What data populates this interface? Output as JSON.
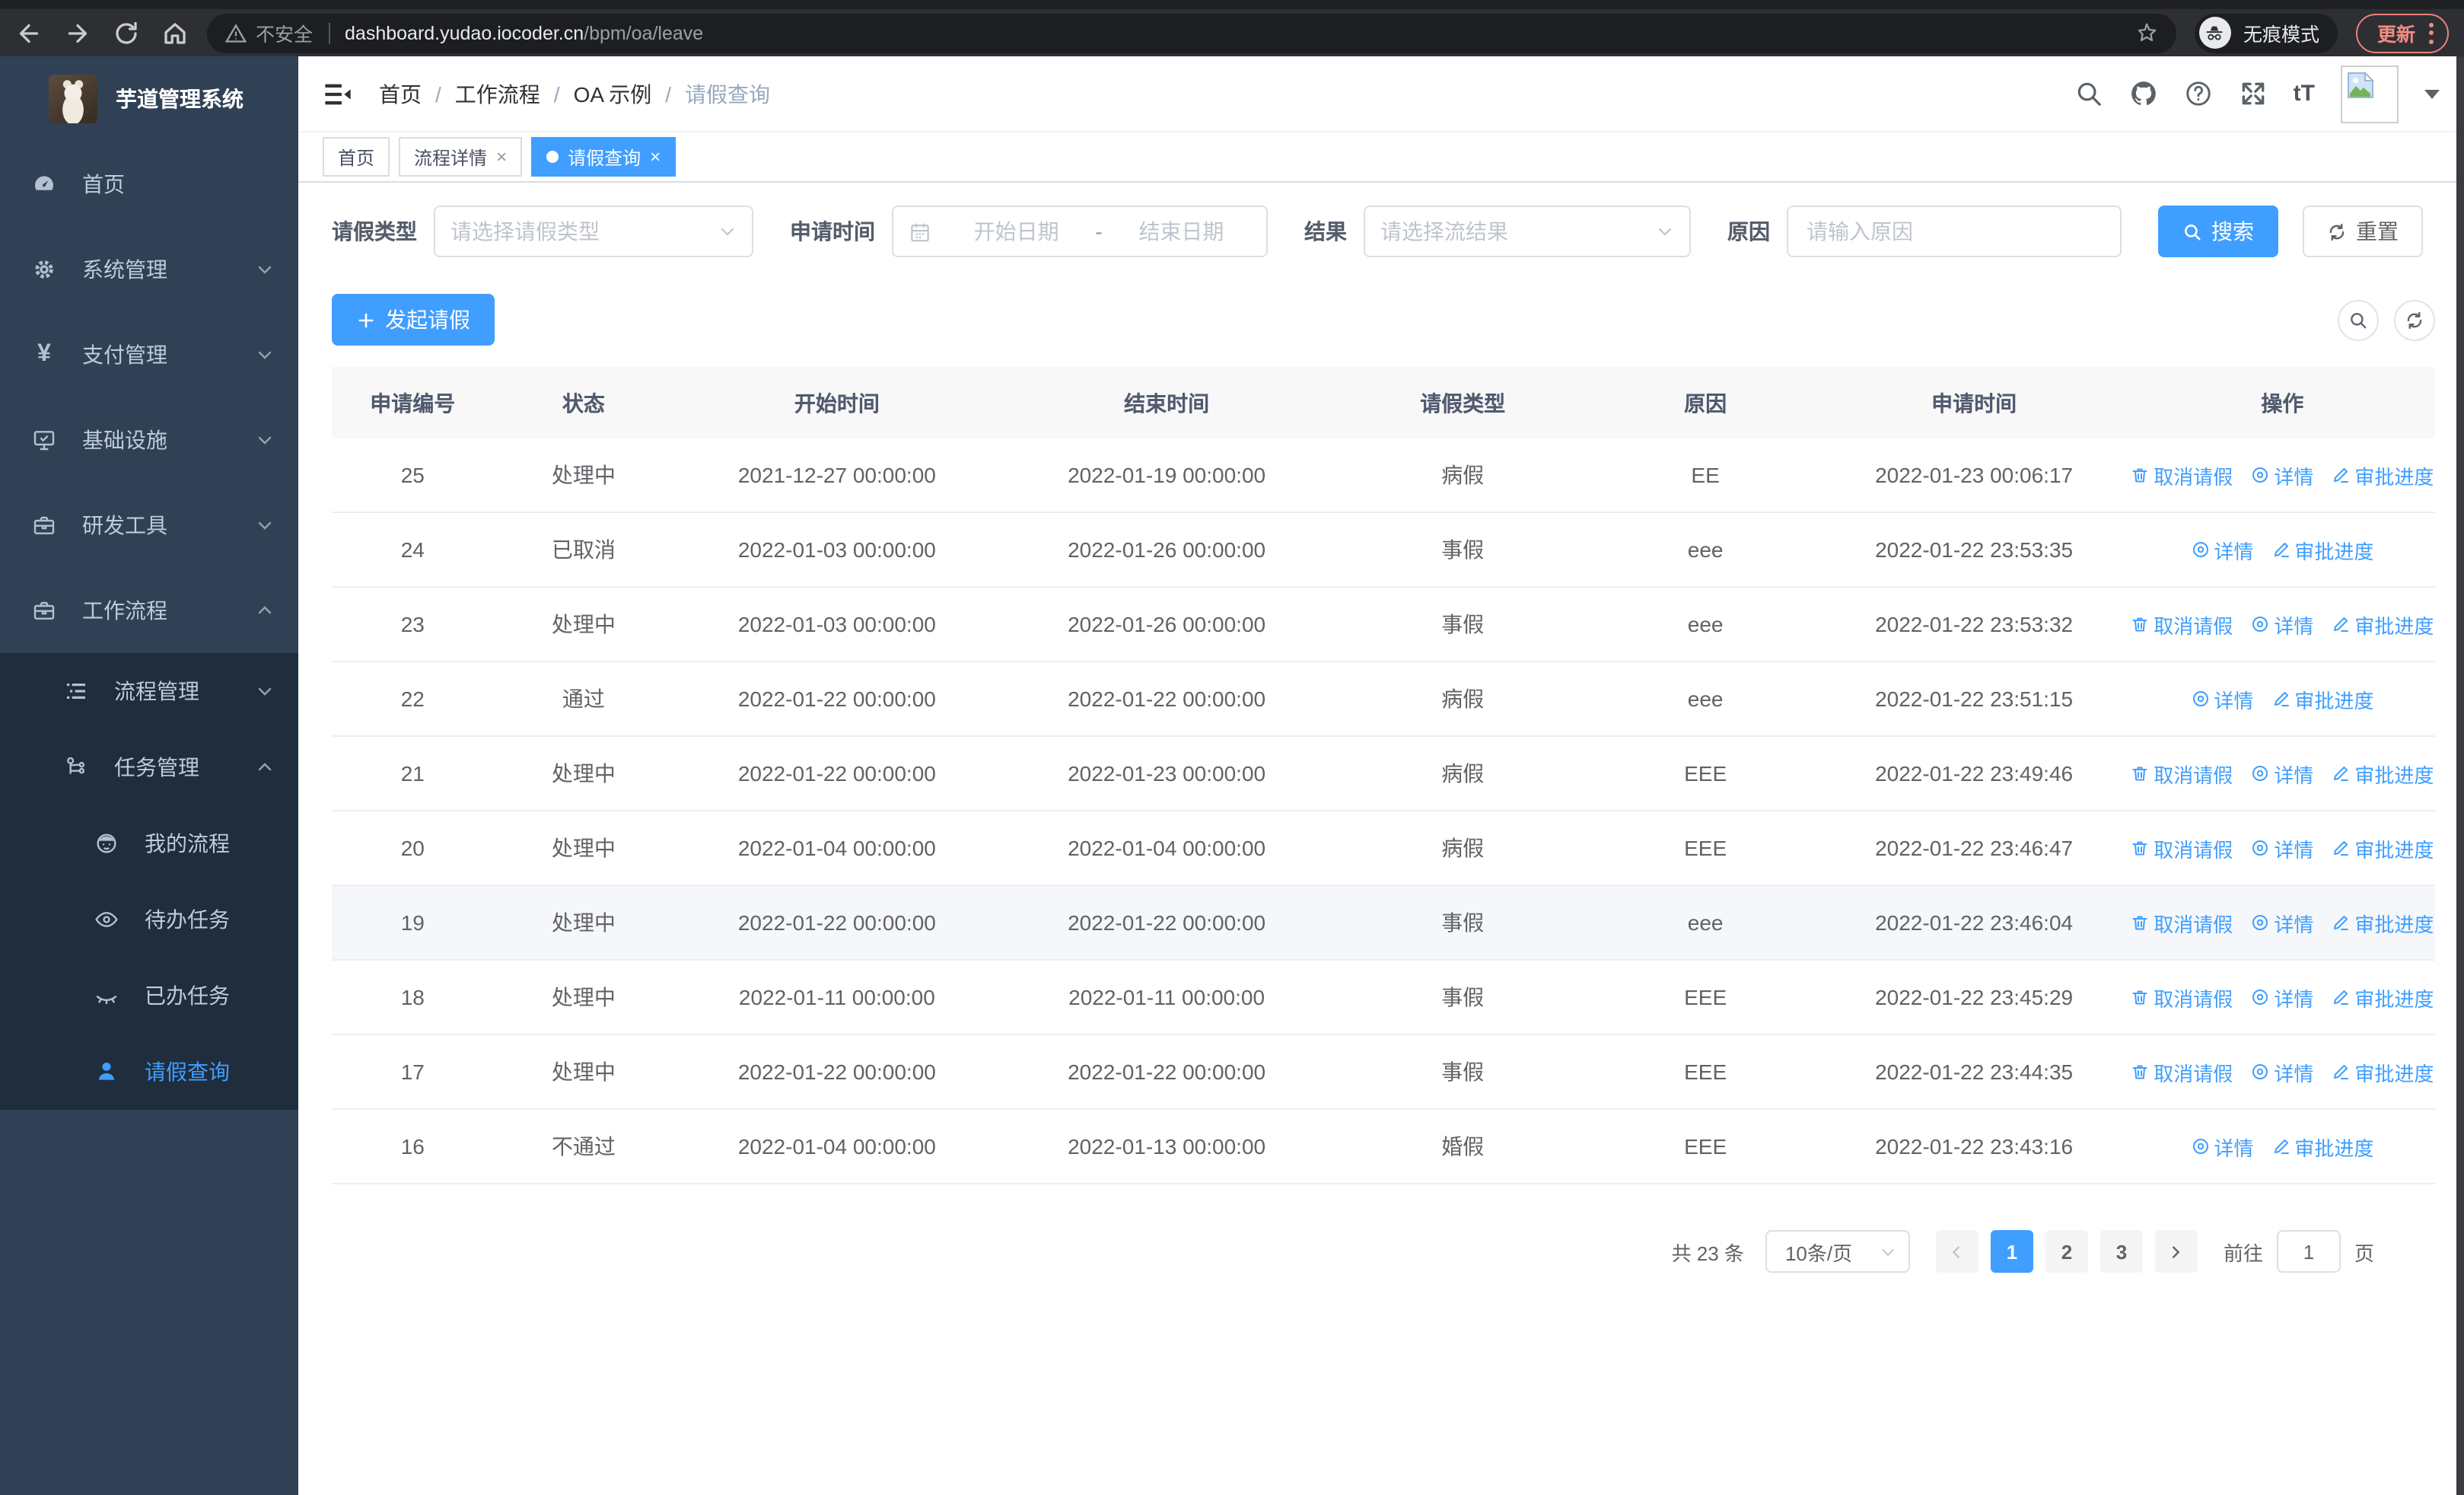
{
  "colors": {
    "accent": "#409eff",
    "sidebar_bg": "#304156",
    "sidebar_submenu_bg": "#1f2d3d",
    "sidebar_text": "#bfcbd9",
    "update_button": "#ef8a80",
    "table_header_bg": "#f8f8f9",
    "hover_row_bg": "#f5f7fa"
  },
  "browser": {
    "security_label": "不安全",
    "url_host": "dashboard.yudao.iocoder.cn",
    "url_path": "/bpm/oa/leave",
    "incognito_label": "无痕模式",
    "update_label": "更新"
  },
  "header": {
    "font_size_glyph": "tT"
  },
  "icons": {
    "yen": "¥",
    "close": "×"
  },
  "sidebar": {
    "title": "芋道管理系统",
    "items": [
      {
        "label": "首页",
        "icon": "dashboard-icon"
      },
      {
        "label": "系统管理",
        "icon": "gear-icon"
      },
      {
        "label": "支付管理",
        "icon": "yen-icon"
      },
      {
        "label": "基础设施",
        "icon": "monitor-icon"
      },
      {
        "label": "研发工具",
        "icon": "toolbox-icon"
      },
      {
        "label": "工作流程",
        "icon": "toolbox-icon"
      }
    ],
    "workflow_children": [
      {
        "label": "流程管理",
        "icon": "tree-list-icon"
      },
      {
        "label": "任务管理",
        "icon": "branch-icon"
      }
    ],
    "task_children": [
      {
        "label": "我的流程",
        "icon": "face-icon"
      },
      {
        "label": "待办任务",
        "icon": "eye-open-icon"
      },
      {
        "label": "已办任务",
        "icon": "eye-closed-icon"
      },
      {
        "label": "请假查询",
        "icon": "user-icon",
        "active": true
      }
    ]
  },
  "breadcrumb": {
    "separator": "/",
    "items": [
      "首页",
      "工作流程",
      "OA 示例",
      "请假查询"
    ]
  },
  "tabs": [
    {
      "label": "首页",
      "closable": false,
      "active": false
    },
    {
      "label": "流程详情",
      "closable": true,
      "active": false
    },
    {
      "label": "请假查询",
      "closable": true,
      "active": true
    }
  ],
  "filters": {
    "leave_type": {
      "label": "请假类型",
      "placeholder": "请选择请假类型"
    },
    "apply_time": {
      "label": "申请时间",
      "start_placeholder": "开始日期",
      "separator": "-",
      "end_placeholder": "结束日期"
    },
    "result": {
      "label": "结果",
      "placeholder": "请选择流结果"
    },
    "reason": {
      "label": "原因",
      "placeholder": "请输入原因"
    },
    "search_label": "搜索",
    "reset_label": "重置"
  },
  "toolbar": {
    "create_label": "发起请假"
  },
  "table": {
    "columns": [
      "申请编号",
      "状态",
      "开始时间",
      "结束时间",
      "请假类型",
      "原因",
      "申请时间",
      "操作"
    ],
    "action_labels": {
      "cancel": "取消请假",
      "detail": "详情",
      "progress": "审批进度"
    },
    "rows": [
      {
        "id": "25",
        "status": "处理中",
        "start": "2021-12-27 00:00:00",
        "end": "2022-01-19 00:00:00",
        "type": "病假",
        "reason": "EE",
        "applied": "2022-01-23 00:06:17",
        "actions": [
          "cancel",
          "detail",
          "progress"
        ],
        "hover": false
      },
      {
        "id": "24",
        "status": "已取消",
        "start": "2022-01-03 00:00:00",
        "end": "2022-01-26 00:00:00",
        "type": "事假",
        "reason": "eee",
        "applied": "2022-01-22 23:53:35",
        "actions": [
          "detail",
          "progress"
        ],
        "hover": false
      },
      {
        "id": "23",
        "status": "处理中",
        "start": "2022-01-03 00:00:00",
        "end": "2022-01-26 00:00:00",
        "type": "事假",
        "reason": "eee",
        "applied": "2022-01-22 23:53:32",
        "actions": [
          "cancel",
          "detail",
          "progress"
        ],
        "hover": false
      },
      {
        "id": "22",
        "status": "通过",
        "start": "2022-01-22 00:00:00",
        "end": "2022-01-22 00:00:00",
        "type": "病假",
        "reason": "eee",
        "applied": "2022-01-22 23:51:15",
        "actions": [
          "detail",
          "progress"
        ],
        "hover": false
      },
      {
        "id": "21",
        "status": "处理中",
        "start": "2022-01-22 00:00:00",
        "end": "2022-01-23 00:00:00",
        "type": "病假",
        "reason": "EEE",
        "applied": "2022-01-22 23:49:46",
        "actions": [
          "cancel",
          "detail",
          "progress"
        ],
        "hover": false
      },
      {
        "id": "20",
        "status": "处理中",
        "start": "2022-01-04 00:00:00",
        "end": "2022-01-04 00:00:00",
        "type": "病假",
        "reason": "EEE",
        "applied": "2022-01-22 23:46:47",
        "actions": [
          "cancel",
          "detail",
          "progress"
        ],
        "hover": false
      },
      {
        "id": "19",
        "status": "处理中",
        "start": "2022-01-22 00:00:00",
        "end": "2022-01-22 00:00:00",
        "type": "事假",
        "reason": "eee",
        "applied": "2022-01-22 23:46:04",
        "actions": [
          "cancel",
          "detail",
          "progress"
        ],
        "hover": true
      },
      {
        "id": "18",
        "status": "处理中",
        "start": "2022-01-11 00:00:00",
        "end": "2022-01-11 00:00:00",
        "type": "事假",
        "reason": "EEE",
        "applied": "2022-01-22 23:45:29",
        "actions": [
          "cancel",
          "detail",
          "progress"
        ],
        "hover": false
      },
      {
        "id": "17",
        "status": "处理中",
        "start": "2022-01-22 00:00:00",
        "end": "2022-01-22 00:00:00",
        "type": "事假",
        "reason": "EEE",
        "applied": "2022-01-22 23:44:35",
        "actions": [
          "cancel",
          "detail",
          "progress"
        ],
        "hover": false
      },
      {
        "id": "16",
        "status": "不通过",
        "start": "2022-01-04 00:00:00",
        "end": "2022-01-13 00:00:00",
        "type": "婚假",
        "reason": "EEE",
        "applied": "2022-01-22 23:43:16",
        "actions": [
          "detail",
          "progress"
        ],
        "hover": false
      }
    ]
  },
  "pagination": {
    "total_label": "共 23 条",
    "page_size_label": "10条/页",
    "pages": [
      "1",
      "2",
      "3"
    ],
    "active_page": "1",
    "goto_label": "前往",
    "goto_value": "1",
    "unit_label": "页"
  }
}
